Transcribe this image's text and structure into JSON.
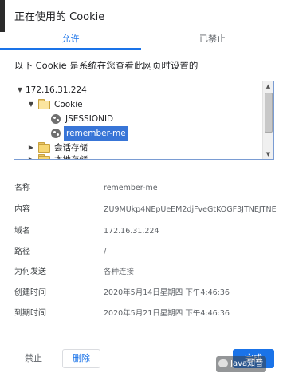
{
  "dialog": {
    "title": "正在使用的 Cookie",
    "tabs": [
      {
        "label": "允许",
        "active": true
      },
      {
        "label": "已禁止",
        "active": false
      }
    ],
    "description": "以下 Cookie 是系统在您查看此网页时设置的"
  },
  "tree": {
    "items": [
      {
        "label": "172.16.31.224",
        "type": "site",
        "expanded": true
      },
      {
        "label": "Cookie",
        "type": "folder",
        "expanded": true
      },
      {
        "label": "JSESSIONID",
        "type": "cookie"
      },
      {
        "label": "remember-me",
        "type": "cookie",
        "selected": true
      },
      {
        "label": "会话存储",
        "type": "folder",
        "expanded": false
      },
      {
        "label": "本地存储",
        "type": "folder",
        "expanded": false
      }
    ]
  },
  "details": [
    {
      "label": "名称",
      "value": "remember-me"
    },
    {
      "label": "内容",
      "value": "ZU9MUkp4NEpUeEM2djFveGtKOGF3JTNEJTNE"
    },
    {
      "label": "域名",
      "value": "172.16.31.224"
    },
    {
      "label": "路径",
      "value": "/"
    },
    {
      "label": "为何发送",
      "value": "各种连接"
    },
    {
      "label": "创建时间",
      "value": "2020年5月14日星期四 下午4:46:36"
    },
    {
      "label": "到期时间",
      "value": "2020年5月21日星期四 下午4:46:36"
    }
  ],
  "buttons": {
    "block": "禁止",
    "delete": "删除",
    "done": "完成"
  },
  "watermark": "Java知音",
  "colors": {
    "accent": "#1a73e8",
    "selection": "#3875d7"
  }
}
